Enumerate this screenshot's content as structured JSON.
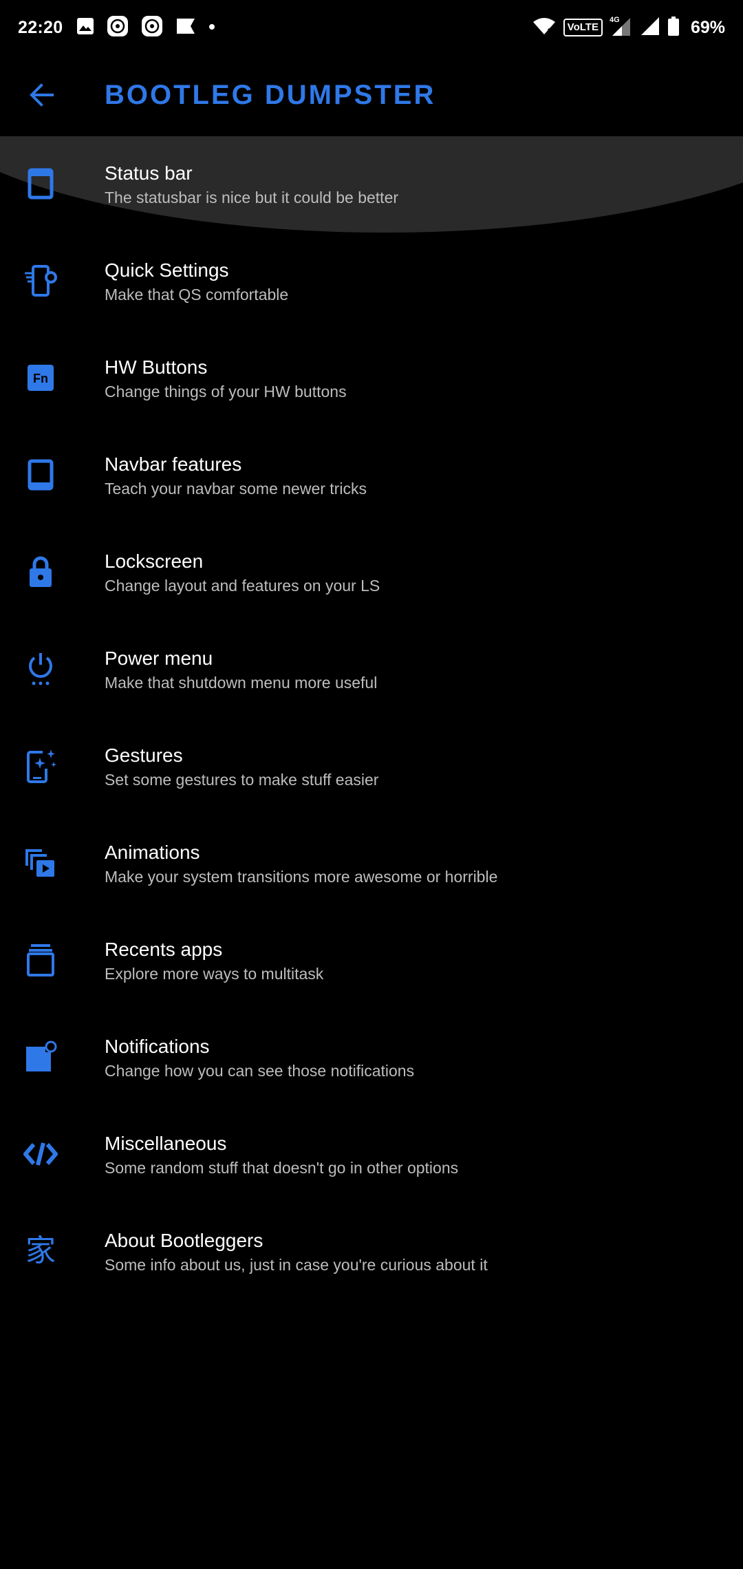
{
  "status_bar": {
    "time": "22:20",
    "left_icons": [
      "image-icon",
      "app-badge-icon",
      "app-badge-icon",
      "flag-icon",
      "dot-icon"
    ],
    "volte": "VoLTE",
    "network": "4G",
    "battery_percent": "69%",
    "battery_level": 0.69
  },
  "app_bar": {
    "title": "BOOTLEG DUMPSTER",
    "accent": "#2f78e8"
  },
  "menu": [
    {
      "icon": "status-bar-icon",
      "title": "Status bar",
      "subtitle": "The statusbar is nice but it could be better"
    },
    {
      "icon": "quick-settings-icon",
      "title": "Quick Settings",
      "subtitle": "Make that QS comfortable"
    },
    {
      "icon": "fn-key-icon",
      "title": "HW Buttons",
      "subtitle": "Change things of your HW buttons",
      "icon_text": "Fn"
    },
    {
      "icon": "navbar-icon",
      "title": "Navbar features",
      "subtitle": "Teach your navbar some newer tricks"
    },
    {
      "icon": "lock-icon",
      "title": "Lockscreen",
      "subtitle": "Change layout and features on your LS"
    },
    {
      "icon": "power-menu-icon",
      "title": "Power menu",
      "subtitle": "Make that shutdown menu more useful"
    },
    {
      "icon": "gestures-icon",
      "title": "Gestures",
      "subtitle": "Set some gestures to make stuff easier"
    },
    {
      "icon": "animations-icon",
      "title": "Animations",
      "subtitle": "Make your system transitions more awesome or horrible"
    },
    {
      "icon": "recents-icon",
      "title": "Recents apps",
      "subtitle": "Explore more ways to multitask"
    },
    {
      "icon": "notifications-icon",
      "title": "Notifications",
      "subtitle": "Change how you can see those notifications"
    },
    {
      "icon": "code-icon",
      "title": "Miscellaneous",
      "subtitle": "Some random stuff that doesn't go in other options"
    },
    {
      "icon": "home-glyph-icon",
      "title": "About Bootleggers",
      "subtitle": "Some info about us, just in case you're curious about it",
      "icon_text": "家"
    }
  ]
}
